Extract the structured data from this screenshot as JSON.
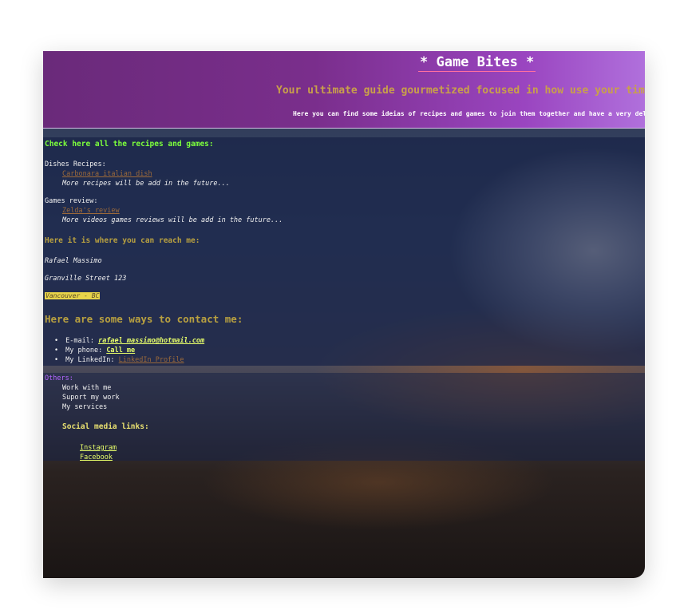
{
  "header": {
    "title": "* Game Bites *",
    "tagline": "Your ultimate guide gourmetized focused in how use your time during the weekend",
    "intro": "Here you can find some ideias of recipes and games to join them together and have a very delightfull weekend."
  },
  "recipes_section": {
    "heading": "Check here all the recipes and games:",
    "dishes_label": "Dishes Recipes:",
    "dish_link": "Carbonara italian dish",
    "dishes_note": "More recipes will be add in the future...",
    "games_label": "Games review:",
    "game_link": "Zelda's review",
    "games_note": "More videos games reviews will be add in the future..."
  },
  "reach": {
    "heading": "Here it is where you can reach me:",
    "name": "Rafael Massimo",
    "street": "Granville Street 123",
    "city": "Vancouver - BC"
  },
  "contact": {
    "heading": "Here are some ways to contact me:",
    "email_label": "E-mail:",
    "email_value": "rafael_massimo@hotmail.com",
    "phone_label": "My phone:",
    "phone_value": "Call me",
    "linkedin_label": "My LinkedIn:",
    "linkedin_value": "LinkedIn Profile"
  },
  "others": {
    "label": "Others:",
    "items": [
      "Work with me",
      "Suport my work",
      "My services"
    ],
    "social_heading": "Social media links:",
    "social_links": [
      "Instagram",
      "Facebook"
    ]
  },
  "colors": {
    "header_purple": "#7a2e8c",
    "heading_green": "#7cff3c",
    "heading_gold": "#b8a040",
    "link_yellow": "#e8ff6a",
    "link_brown": "#9c6a3a",
    "others_purple": "#b466ff"
  }
}
